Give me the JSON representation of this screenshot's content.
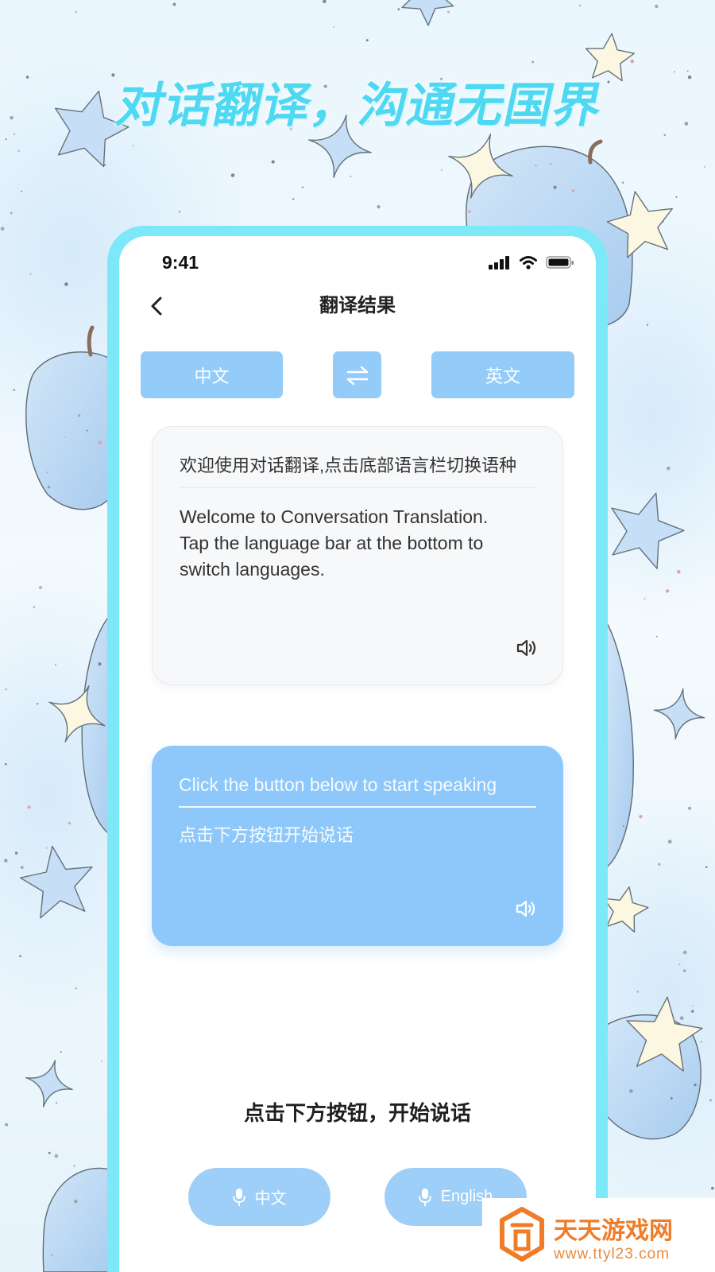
{
  "headline": "对话翻译，沟通无国界",
  "status_bar": {
    "time": "9:41",
    "icons": [
      "signal-icon",
      "wifi-icon",
      "battery-icon"
    ]
  },
  "nav": {
    "back_icon": "back-chevron-icon",
    "title": "翻译结果"
  },
  "language_bar": {
    "source_label": "中文",
    "swap_icon": "swap-icon",
    "target_label": "英文"
  },
  "result_card": {
    "source_text": "欢迎使用对话翻译,点击底部语言栏切换语种",
    "translated_text": "Welcome to Conversation Translation. Tap the language bar at the bottom to switch languages.",
    "speaker_icon": "speaker-icon"
  },
  "input_card": {
    "source_text": "Click the button below to start speaking",
    "translated_text": "点击下方按钮开始说话",
    "speaker_icon": "speaker-icon"
  },
  "prompt": "点击下方按钮，开始说话",
  "mic_buttons": [
    {
      "label": "中文",
      "icon": "microphone-icon"
    },
    {
      "label": "English",
      "icon": "microphone-icon"
    }
  ],
  "watermark": {
    "name": "天天游戏网",
    "url": "www.ttyl23.com",
    "icon": "cube-logo-icon"
  },
  "colors": {
    "headline": "#4fd8f2",
    "phone_frame": "#7de8f8",
    "accent_blue": "#8ec8fa",
    "button_blue": "#93cbf9",
    "mic_button_blue": "#9ecff8",
    "watermark_orange": "#f07c28"
  }
}
